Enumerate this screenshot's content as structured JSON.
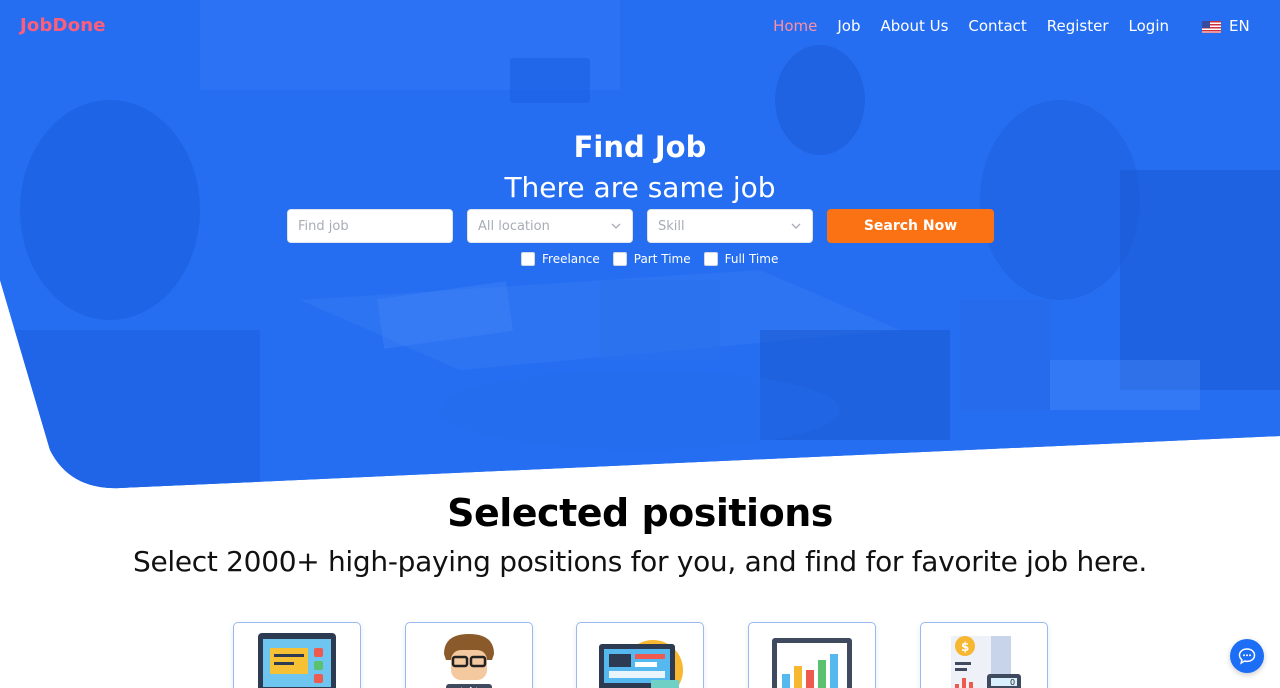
{
  "brand": {
    "name": "JobDone",
    "color": "#ff5e7a"
  },
  "nav": {
    "items": [
      {
        "label": "Home",
        "active": true
      },
      {
        "label": "Job",
        "active": false
      },
      {
        "label": "About Us",
        "active": false
      },
      {
        "label": "Contact",
        "active": false
      },
      {
        "label": "Register",
        "active": false
      },
      {
        "label": "Login",
        "active": false
      }
    ],
    "language": {
      "code": "EN",
      "icon": "us-flag-icon"
    }
  },
  "hero": {
    "title": "Find Job",
    "subtitle": "There are same job",
    "search": {
      "job_placeholder": "Find job",
      "location_placeholder": "All location",
      "skill_placeholder": "Skill",
      "button_label": "Search Now"
    },
    "filters": [
      {
        "label": "Freelance",
        "checked": false
      },
      {
        "label": "Part Time",
        "checked": false
      },
      {
        "label": "Full Time",
        "checked": false
      }
    ]
  },
  "positions": {
    "title": "Selected positions",
    "subtitle": "Select 2000+ high-paying positions for you, and find for favorite job here.",
    "cards": [
      {
        "icon": "web-design-icon"
      },
      {
        "icon": "developer-icon"
      },
      {
        "icon": "dashboard-icon"
      },
      {
        "icon": "analytics-chart-icon"
      },
      {
        "icon": "finance-calculator-icon"
      }
    ]
  },
  "chat": {
    "icon": "chat-bubble-icon"
  },
  "colors": {
    "primary": "#1b6ef5",
    "accent": "#fb7215",
    "active_nav": "#ff8fa3"
  }
}
